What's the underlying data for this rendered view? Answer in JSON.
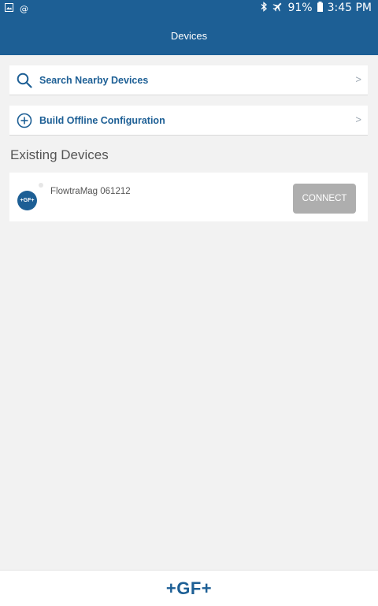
{
  "status_bar": {
    "icons_left": [
      "image-icon",
      "at-icon"
    ],
    "icons_right": [
      "bluetooth-icon",
      "airplane-icon",
      "battery-icon"
    ],
    "battery": "91%",
    "time": "3:45 PM"
  },
  "header": {
    "title": "Devices"
  },
  "actions": [
    {
      "label": "Search Nearby Devices",
      "icon": "search-icon",
      "chevron": ">"
    },
    {
      "label": "Build Offline Configuration",
      "icon": "plus-circle-icon",
      "chevron": ">"
    }
  ],
  "existing": {
    "title": "Existing Devices",
    "devices": [
      {
        "name": "FlowtraMag 061212",
        "logo": "+GF+",
        "button": "CONNECT"
      }
    ]
  },
  "footer": {
    "brand": "+GF+"
  },
  "colors": {
    "primary": "#1d5f95",
    "button_disabled": "#aeaeae",
    "background": "#f2f2f2"
  }
}
